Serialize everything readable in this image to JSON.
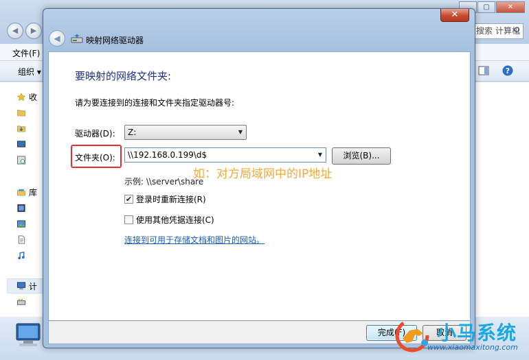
{
  "background_window": {
    "search_text": "搜索 计算机",
    "menu_file": "文件(F)",
    "toolbar_organize": "组织 ▾",
    "sidebar_items": [
      "收",
      "",
      "",
      "",
      "",
      "库",
      "",
      "",
      "",
      "",
      "计",
      "",
      ""
    ]
  },
  "dialog": {
    "title": "映射网络驱动器",
    "close_glyph": "✕",
    "heading": "要映射的网络文件夹:",
    "description": "请为要连接到的连接和文件夹指定驱动器号:",
    "drive_label": "驱动器(D):",
    "drive_value": "Z:",
    "folder_label": "文件夹(O):",
    "folder_value": "\\\\192.168.0.199\\d$",
    "browse_label": "浏览(B)...",
    "example_text": "示例: \\\\server\\share",
    "reconnect_label": "登录时重新连接(R)",
    "reconnect_checked": true,
    "other_credentials_label": "使用其他凭据连接(C)",
    "other_credentials_checked": false,
    "link_text": "连接到可用于存储文档和图片的网站。",
    "finish_label": "完成(F)",
    "cancel_label": "取消"
  },
  "annotation": {
    "text": "如：对方局域网中的IP地址",
    "color": "#f2a93b"
  },
  "watermark": {
    "brand": "小马系统",
    "url": "www.xiaomaxitong.com"
  },
  "colors": {
    "heading": "#1e3287",
    "link": "#1a5fb4",
    "highlight_box": "#e03030"
  }
}
